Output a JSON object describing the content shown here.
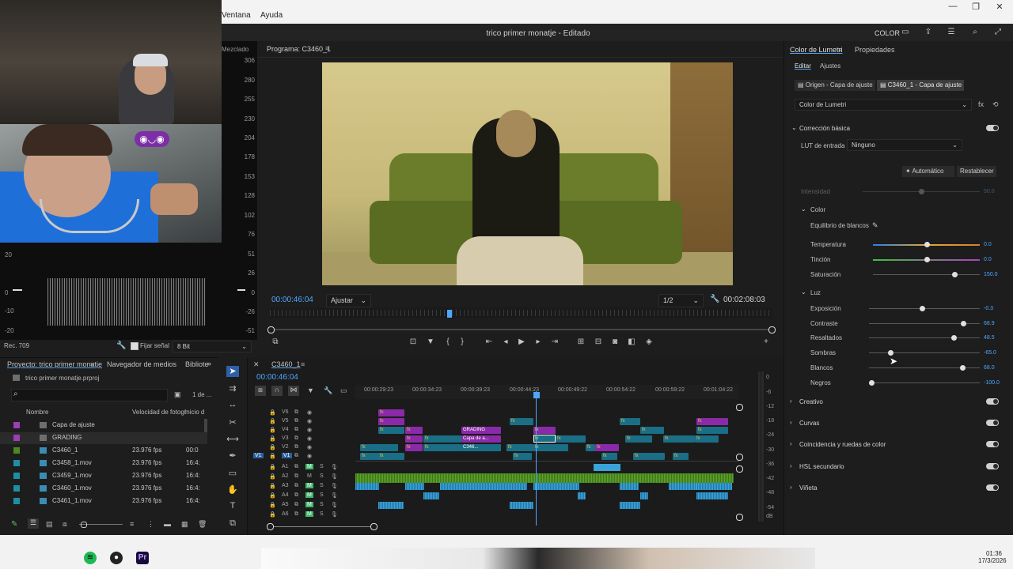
{
  "menu": {
    "ventana": "Ventana",
    "ayuda": "Ayuda"
  },
  "header": {
    "title": "trico primer monatje - Editado",
    "workspace": "COLOR"
  },
  "scope": {
    "tab": "Mezclado",
    "ticks": [
      "306",
      "280",
      "255",
      "230",
      "204",
      "178",
      "153",
      "128",
      "102",
      "76",
      "51",
      "26",
      "0",
      "-26",
      "-51"
    ],
    "left_ticks": [
      "20",
      "0",
      "-10",
      "-20"
    ],
    "footer_rec": "Rec. 709",
    "fijar_label": "Fijar señal",
    "bit_value": "8 Bit"
  },
  "program": {
    "title": "Programa: C3460_1",
    "timecode": "00:00:46:04",
    "fit": "Ajustar",
    "resolution": "1/2",
    "duration": "00:02:08:03"
  },
  "project": {
    "tab_project": "Proyecto: trico primer monatje",
    "tab_media": "Navegador de medios",
    "tab_library": "Bibliote",
    "file": "trico primer monatje.prproj",
    "count": "1 de ...",
    "col_name": "Nombre",
    "col_fps": "Velocidad de fotogr",
    "col_start": "Inicio d",
    "rows": [
      {
        "name": "Capa de ajuste",
        "fps": "",
        "start": "",
        "swatch": "#9b3fb5"
      },
      {
        "name": "GRADING",
        "fps": "",
        "start": "",
        "swatch": "#9b3fb5"
      },
      {
        "name": "C3460_1",
        "fps": "23.976 fps",
        "start": "00:0",
        "swatch": "#4a8a1e"
      },
      {
        "name": "C3458_1.mov",
        "fps": "23.976 fps",
        "start": "16:4:",
        "swatch": "#1d8fa3"
      },
      {
        "name": "C3459_1.mov",
        "fps": "23.976 fps",
        "start": "16:4:",
        "swatch": "#1d8fa3"
      },
      {
        "name": "C3460_1.mov",
        "fps": "23.976 fps",
        "start": "16:4:",
        "swatch": "#1d8fa3"
      },
      {
        "name": "C3461_1.mov",
        "fps": "23.976 fps",
        "start": "16:4:",
        "swatch": "#1d8fa3"
      }
    ]
  },
  "timeline": {
    "tab": "C3460_1",
    "timecode": "00:00:46:04",
    "ruler": [
      "00:00:29:23",
      "00:00:34:23",
      "00:00:39:23",
      "00:00:44:23",
      "00:00:49:22",
      "00:00:54:22",
      "00:00:59:22",
      "00:01:04:22"
    ],
    "video_tracks": [
      "V6",
      "V5",
      "V4",
      "V3",
      "V2",
      "V1"
    ],
    "audio_tracks": [
      "A1",
      "A2",
      "A3",
      "A4",
      "A5",
      "A6"
    ],
    "clip_grading": "GRADING",
    "clip_capa": "Capa de a...",
    "clip_c3460": "C346...",
    "fx": "fx"
  },
  "meters": {
    "ticks": [
      "0",
      "-6",
      "-12",
      "-18",
      "-24",
      "-30",
      "-36",
      "-42",
      "-48",
      "-54",
      "dB"
    ]
  },
  "lumetri": {
    "tab_color": "Color de Lumetri",
    "tab_props": "Propiedades",
    "sub_edit": "Editar",
    "sub_settings": "Ajustes",
    "origin": "Origen - Capa de ajuste",
    "target": "C3460_1 - Capa de ajuste",
    "effect": "Color de Lumetri",
    "basic": "Corrección básica",
    "lut_label": "LUT de entrada",
    "lut_value": "Ninguno",
    "auto": "Automático",
    "reset": "Restablecer",
    "intensity": "Intensidad",
    "intensity_value": "50.0",
    "color_section": "Color",
    "wb": "Equilibrio de blancos",
    "temp": "Temperatura",
    "temp_value": "0.0",
    "tint": "Tinción",
    "tint_value": "0.0",
    "sat": "Saturación",
    "sat_value": "150.0",
    "light": "Luz",
    "exposure": "Exposición",
    "exposure_value": "-0.3",
    "contrast": "Contraste",
    "contrast_value": "68.9",
    "highlights": "Resaltados",
    "highlights_value": "48.5",
    "shadows": "Sombras",
    "shadows_value": "-65.0",
    "whites": "Blancos",
    "whites_value": "68.0",
    "blacks": "Negros",
    "blacks_value": "-100.0",
    "creative": "Creativo",
    "curves": "Curvas",
    "wheels": "Coincidencia y ruedas de color",
    "hsl": "HSL secundario",
    "vignette": "Viñeta"
  },
  "taskbar": {
    "time": "01:36",
    "date": "17/3/2026"
  }
}
